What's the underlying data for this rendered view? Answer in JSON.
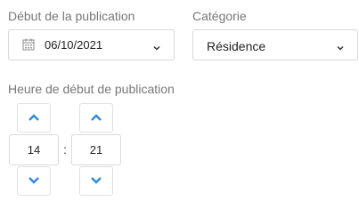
{
  "publication_start": {
    "label": "Début de la publication",
    "date_value": "06/10/2021"
  },
  "category": {
    "label": "Catégorie",
    "value": "Résidence"
  },
  "start_time": {
    "label": "Heure de début de publication",
    "hours": "14",
    "separator": ":",
    "minutes": "21"
  },
  "colors": {
    "accent": "#2f8bdc",
    "label": "#777777",
    "border": "#d9d9d9"
  },
  "icons": {
    "calendar": "calendar-icon",
    "dropdown": "chevron-down-icon",
    "increment": "chevron-up-icon",
    "decrement": "chevron-down-icon"
  }
}
